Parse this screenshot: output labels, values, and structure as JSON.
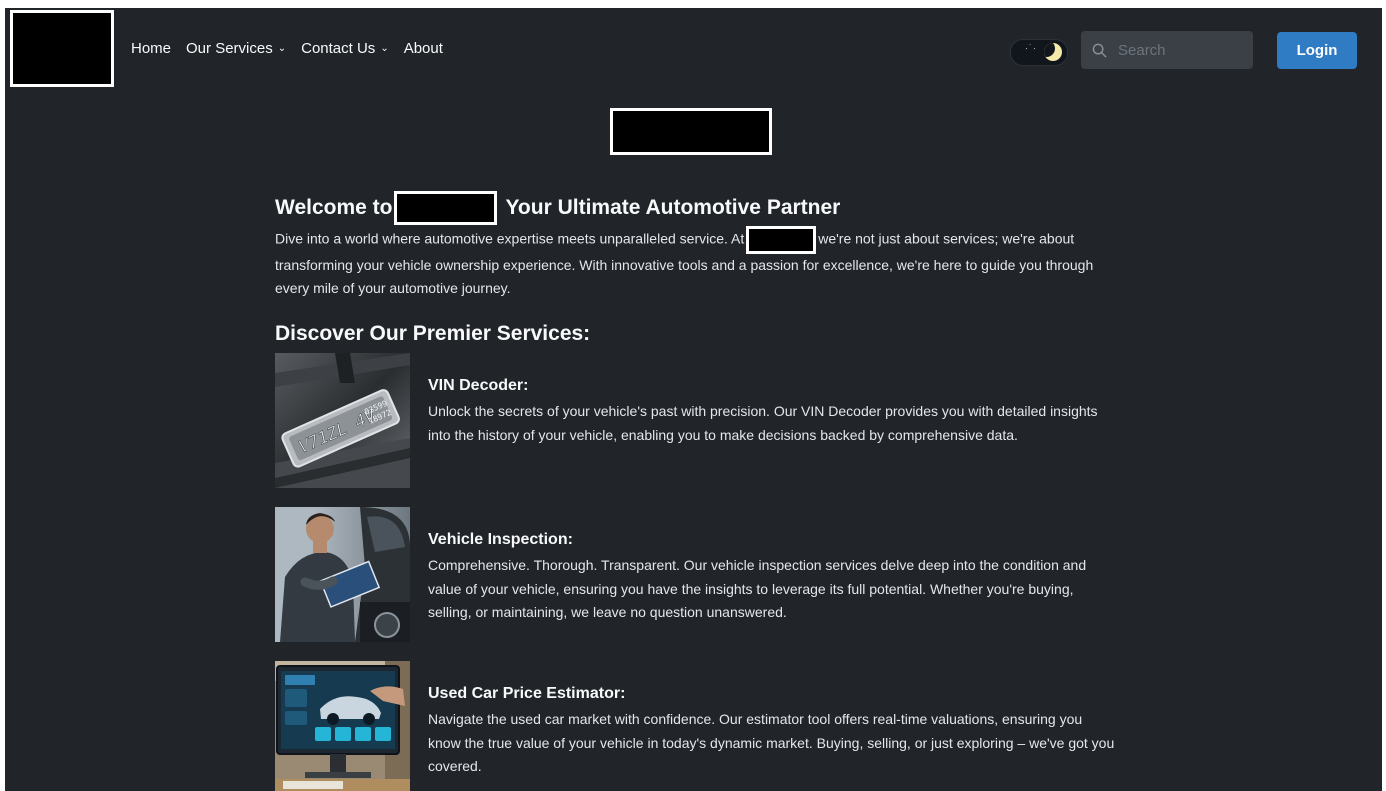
{
  "nav": {
    "links": [
      {
        "label": "Home",
        "dropdown": false
      },
      {
        "label": "Our Services",
        "dropdown": true
      },
      {
        "label": "Contact Us",
        "dropdown": true
      },
      {
        "label": "About",
        "dropdown": false
      }
    ],
    "theme_icon": "moon-icon",
    "search": {
      "placeholder": "Search",
      "value": "",
      "icon": "search-icon"
    },
    "login_label": "Login"
  },
  "main": {
    "welcome_prefix": "Welcome to",
    "welcome_suffix": "Your Ultimate Automotive Partner",
    "intro_part1": "Dive into a world where automotive expertise meets unparalleled service. At",
    "intro_part2": "we're not just about services; we're about transforming your vehicle ownership experience. With innovative tools and a passion for excellence, we're here to guide you through every mile of your automotive journey.",
    "discover_title": "Discover Our Premier Services:",
    "services": [
      {
        "title": "VIN Decoder:",
        "description": "Unlock the secrets of your vehicle's past with precision. Our VIN Decoder provides you with detailed insights into the history of your vehicle, enabling you to make decisions backed by comprehensive data."
      },
      {
        "title": "Vehicle Inspection:",
        "description": "Comprehensive. Thorough. Transparent. Our vehicle inspection services delve deep into the condition and value of your vehicle, ensuring you have the insights to leverage its full potential. Whether you're buying, selling, or maintaining, we leave no question unanswered."
      },
      {
        "title": "Used Car Price Estimator:",
        "description": "Navigate the used car market with confidence. Our estimator tool offers real-time valuations, ensuring you know the true value of your vehicle in today's dynamic market. Buying, selling, or just exploring – we've got you covered."
      }
    ]
  },
  "colors": {
    "background": "#212529",
    "accent": "#2f7bc4",
    "text": "#f8f9fa"
  }
}
